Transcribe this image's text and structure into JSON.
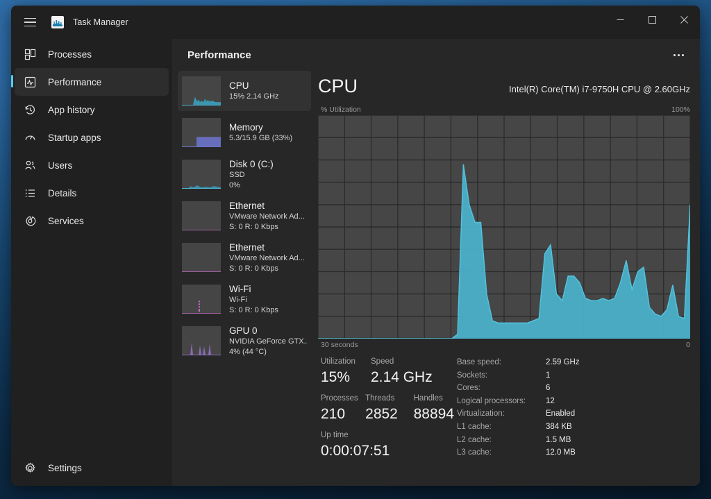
{
  "window": {
    "title": "Task Manager",
    "icon": "task-manager-icon",
    "controls": {
      "minimize": "Minimize",
      "maximize": "Maximize",
      "close": "Close"
    },
    "menu_button": "Open navigation"
  },
  "sidebar": {
    "items": [
      {
        "label": "Processes",
        "icon": "processes-icon",
        "active": false
      },
      {
        "label": "Performance",
        "icon": "performance-icon",
        "active": true
      },
      {
        "label": "App history",
        "icon": "app-history-icon",
        "active": false
      },
      {
        "label": "Startup apps",
        "icon": "startup-apps-icon",
        "active": false
      },
      {
        "label": "Users",
        "icon": "users-icon",
        "active": false
      },
      {
        "label": "Details",
        "icon": "details-icon",
        "active": false
      },
      {
        "label": "Services",
        "icon": "services-icon",
        "active": false
      }
    ],
    "settings": {
      "label": "Settings",
      "icon": "gear-icon"
    }
  },
  "pane": {
    "title": "Performance",
    "more_label": "More options"
  },
  "resources": [
    {
      "name": "CPU",
      "sub1": "15%  2.14 GHz",
      "sub2": "",
      "accent": "#4fb3d1",
      "kind": "cpu",
      "active": true
    },
    {
      "name": "Memory",
      "sub1": "5.3/15.9 GB (33%)",
      "sub2": "",
      "accent": "#6a72c8",
      "kind": "mem",
      "active": false
    },
    {
      "name": "Disk 0 (C:)",
      "sub1": "SSD",
      "sub2": "0%",
      "accent": "#4fb3d1",
      "kind": "disk",
      "active": false
    },
    {
      "name": "Ethernet",
      "sub1": "VMware Network Ad...",
      "sub2": "S: 0 R: 0 Kbps",
      "accent": "#a35fa3",
      "kind": "net",
      "active": false
    },
    {
      "name": "Ethernet",
      "sub1": "VMware Network Ad...",
      "sub2": "S: 0 R: 0 Kbps",
      "accent": "#a35fa3",
      "kind": "net",
      "active": false
    },
    {
      "name": "Wi-Fi",
      "sub1": "Wi-Fi",
      "sub2": "S: 0 R: 0 Kbps",
      "accent": "#c76fc7",
      "kind": "wifi",
      "active": false
    },
    {
      "name": "GPU 0",
      "sub1": "NVIDIA GeForce GTX...",
      "sub2": "4%  (44 °C)",
      "accent": "#8e6fc0",
      "kind": "gpu",
      "active": false
    }
  ],
  "detail": {
    "title": "CPU",
    "model": "Intel(R) Core(TM) i7-9750H CPU @ 2.60GHz",
    "axis_top_left": "% Utilization",
    "axis_top_right": "100%",
    "axis_bottom_left": "30 seconds",
    "axis_bottom_right": "0",
    "stats": {
      "utilization_label": "Utilization",
      "utilization_value": "15%",
      "speed_label": "Speed",
      "speed_value": "2.14 GHz",
      "processes_label": "Processes",
      "processes_value": "210",
      "threads_label": "Threads",
      "threads_value": "2852",
      "handles_label": "Handles",
      "handles_value": "88894",
      "uptime_label": "Up time",
      "uptime_value": "0:00:07:51"
    },
    "specs": [
      {
        "label": "Base speed:",
        "value": "2.59 GHz"
      },
      {
        "label": "Sockets:",
        "value": "1"
      },
      {
        "label": "Cores:",
        "value": "6"
      },
      {
        "label": "Logical processors:",
        "value": "12"
      },
      {
        "label": "Virtualization:",
        "value": "Enabled"
      },
      {
        "label": "L1 cache:",
        "value": "384 KB"
      },
      {
        "label": "L2 cache:",
        "value": "1.5 MB"
      },
      {
        "label": "L3 cache:",
        "value": "12.0 MB"
      }
    ]
  },
  "chart_data": {
    "type": "area",
    "title": "CPU % Utilization over 30 seconds",
    "xlabel": "30 seconds",
    "ylabel": "% Utilization",
    "ylim": [
      0,
      100
    ],
    "xlim": [
      0,
      60
    ],
    "grid": true,
    "grid_cols": 14,
    "grid_rows": 10,
    "color": "#4ab3cd",
    "x": [
      0,
      1,
      2,
      3,
      4,
      5,
      6,
      7,
      8,
      9,
      10,
      11,
      12,
      13,
      14,
      15,
      16,
      17,
      18,
      19,
      20,
      21,
      22,
      23,
      24,
      25,
      26,
      27,
      28,
      29,
      30,
      31,
      32,
      33,
      34,
      35,
      36,
      37,
      38,
      39,
      40,
      41,
      42,
      43,
      44,
      45,
      46,
      47,
      48,
      49,
      50,
      51,
      52,
      53,
      54,
      55,
      56,
      57,
      58,
      59,
      60
    ],
    "values": [
      0,
      0,
      0,
      0,
      0,
      0,
      0,
      0,
      0,
      0,
      0,
      0,
      0,
      0,
      0,
      0,
      0,
      0,
      0,
      0,
      0,
      0,
      0,
      0,
      2,
      78,
      60,
      52,
      52,
      20,
      8,
      7,
      7,
      7,
      7,
      7,
      7,
      8,
      9,
      38,
      42,
      20,
      17,
      28,
      28,
      25,
      18,
      17,
      17,
      18,
      17,
      18,
      25,
      35,
      22,
      30,
      32,
      14,
      11,
      10,
      13,
      24,
      10,
      9,
      60
    ]
  }
}
